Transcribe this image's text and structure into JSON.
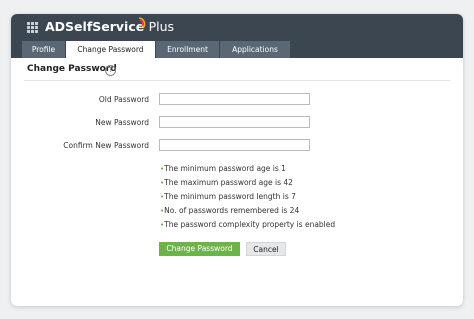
{
  "app": {
    "brand": "ADSelfService",
    "brand_suffix": "Plus"
  },
  "tabs": [
    {
      "label": "Profile",
      "active": false
    },
    {
      "label": "Change Password",
      "active": true
    },
    {
      "label": "Enrollment",
      "active": false
    },
    {
      "label": "Applications",
      "active": false
    }
  ],
  "page": {
    "title": "Change Password",
    "help_icon": "?"
  },
  "form": {
    "old_password_label": "Old Password",
    "new_password_label": "New Password",
    "confirm_password_label": "Confirm New Password",
    "old_password_value": "",
    "new_password_value": "",
    "confirm_password_value": ""
  },
  "policy": {
    "bullet": "•",
    "rules": [
      "The minimum password age is 1",
      "The maximum password age is 42",
      "The minimum password length is 7",
      "No. of passwords remembered is 24",
      "The password complexity property is enabled"
    ]
  },
  "actions": {
    "submit_label": "Change Password",
    "cancel_label": "Cancel"
  },
  "colors": {
    "header": "#3b4651",
    "tab_inactive": "#5a6774",
    "primary_button": "#6cb34c",
    "bullet": "#5fae46"
  }
}
